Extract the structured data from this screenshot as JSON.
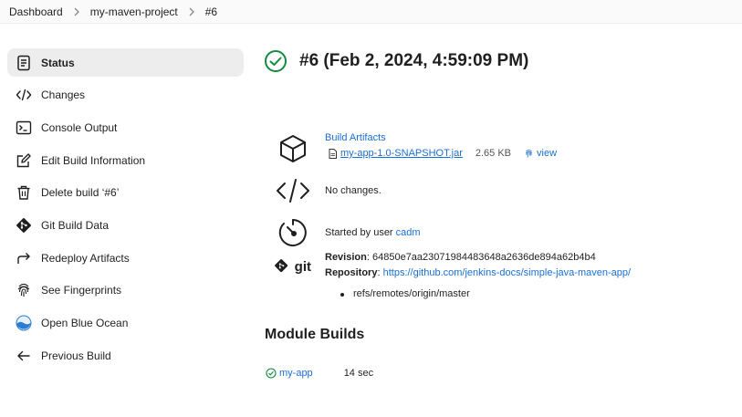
{
  "breadcrumb": {
    "items": [
      "Dashboard",
      "my-maven-project",
      "#6"
    ]
  },
  "sidebar": {
    "items": [
      {
        "label": "Status",
        "icon": "status-icon"
      },
      {
        "label": "Changes",
        "icon": "code-icon"
      },
      {
        "label": "Console Output",
        "icon": "terminal-icon"
      },
      {
        "label": "Edit Build Information",
        "icon": "edit-icon"
      },
      {
        "label": "Delete build ‘#6’",
        "icon": "trash-icon"
      },
      {
        "label": "Git Build Data",
        "icon": "git-icon"
      },
      {
        "label": "Redeploy Artifacts",
        "icon": "redeploy-icon"
      },
      {
        "label": "See Fingerprints",
        "icon": "fingerprint-icon"
      },
      {
        "label": "Open Blue Ocean",
        "icon": "blue-ocean-icon"
      },
      {
        "label": "Previous Build",
        "icon": "arrow-left-icon"
      }
    ]
  },
  "build": {
    "title": "#6 (Feb 2, 2024, 4:59:09 PM)",
    "status_color": "#138a3c"
  },
  "artifacts": {
    "heading": "Build Artifacts",
    "file": "my-app-1.0-SNAPSHOT.jar",
    "size": "2.65 KB",
    "view": "view"
  },
  "changes": {
    "text": "No changes."
  },
  "started": {
    "prefix": "Started by user ",
    "user": "cadm"
  },
  "git": {
    "logo_text": "git",
    "revision_label": "Revision",
    "revision": "64850e7aa23071984483648a2636de894a62b4b4",
    "repository_label": "Repository",
    "repository": "https://github.com/jenkins-docs/simple-java-maven-app/",
    "branch": "refs/remotes/origin/master"
  },
  "modules": {
    "heading": "Module Builds",
    "items": [
      {
        "name": "my-app",
        "duration": "14 sec"
      }
    ]
  },
  "colors": {
    "link": "#1a6fd4",
    "success": "#138a3c",
    "active_bg": "#ededed"
  }
}
